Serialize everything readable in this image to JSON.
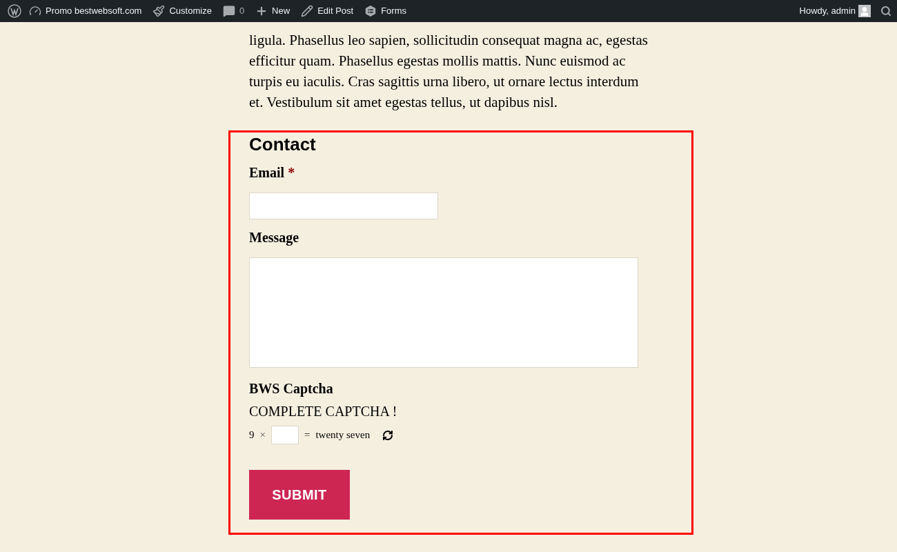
{
  "admin_bar": {
    "items": [
      {
        "kind": "wp"
      },
      {
        "kind": "dashboard",
        "label": "Promo bestwebsoft.com"
      },
      {
        "kind": "brush",
        "label": "Customize"
      },
      {
        "kind": "comment",
        "label": "0"
      },
      {
        "kind": "plus",
        "label": "New"
      },
      {
        "kind": "pencil",
        "label": "Edit Post"
      },
      {
        "kind": "forms",
        "label": "Forms"
      }
    ],
    "greeting": "Howdy, admin"
  },
  "paragraph_above": [
    "ligula. Phasellus leo sapien, sollicitudin consequat magna ac, egestas efficitur quam. Phasellus egestas mollis mattis. Nunc euismod ac turpis eu iaculis. Cras sagittis urna libero, ut ornare lectus interdum et. Vestibulum sit amet egestas tellus, ut dapibus nisl."
  ],
  "form": {
    "title": "Contact",
    "fields": [
      {
        "kind": "input",
        "label": "Email",
        "required_mark": "*"
      },
      {
        "kind": "textarea",
        "label": "Message"
      }
    ],
    "captcha": {
      "label": "BWS Captcha",
      "prompt": "COMPLETE CAPTCHA !",
      "operand": "9",
      "operator": "×",
      "equals": "=",
      "result": "twenty seven"
    },
    "submit": "SUBMIT"
  }
}
